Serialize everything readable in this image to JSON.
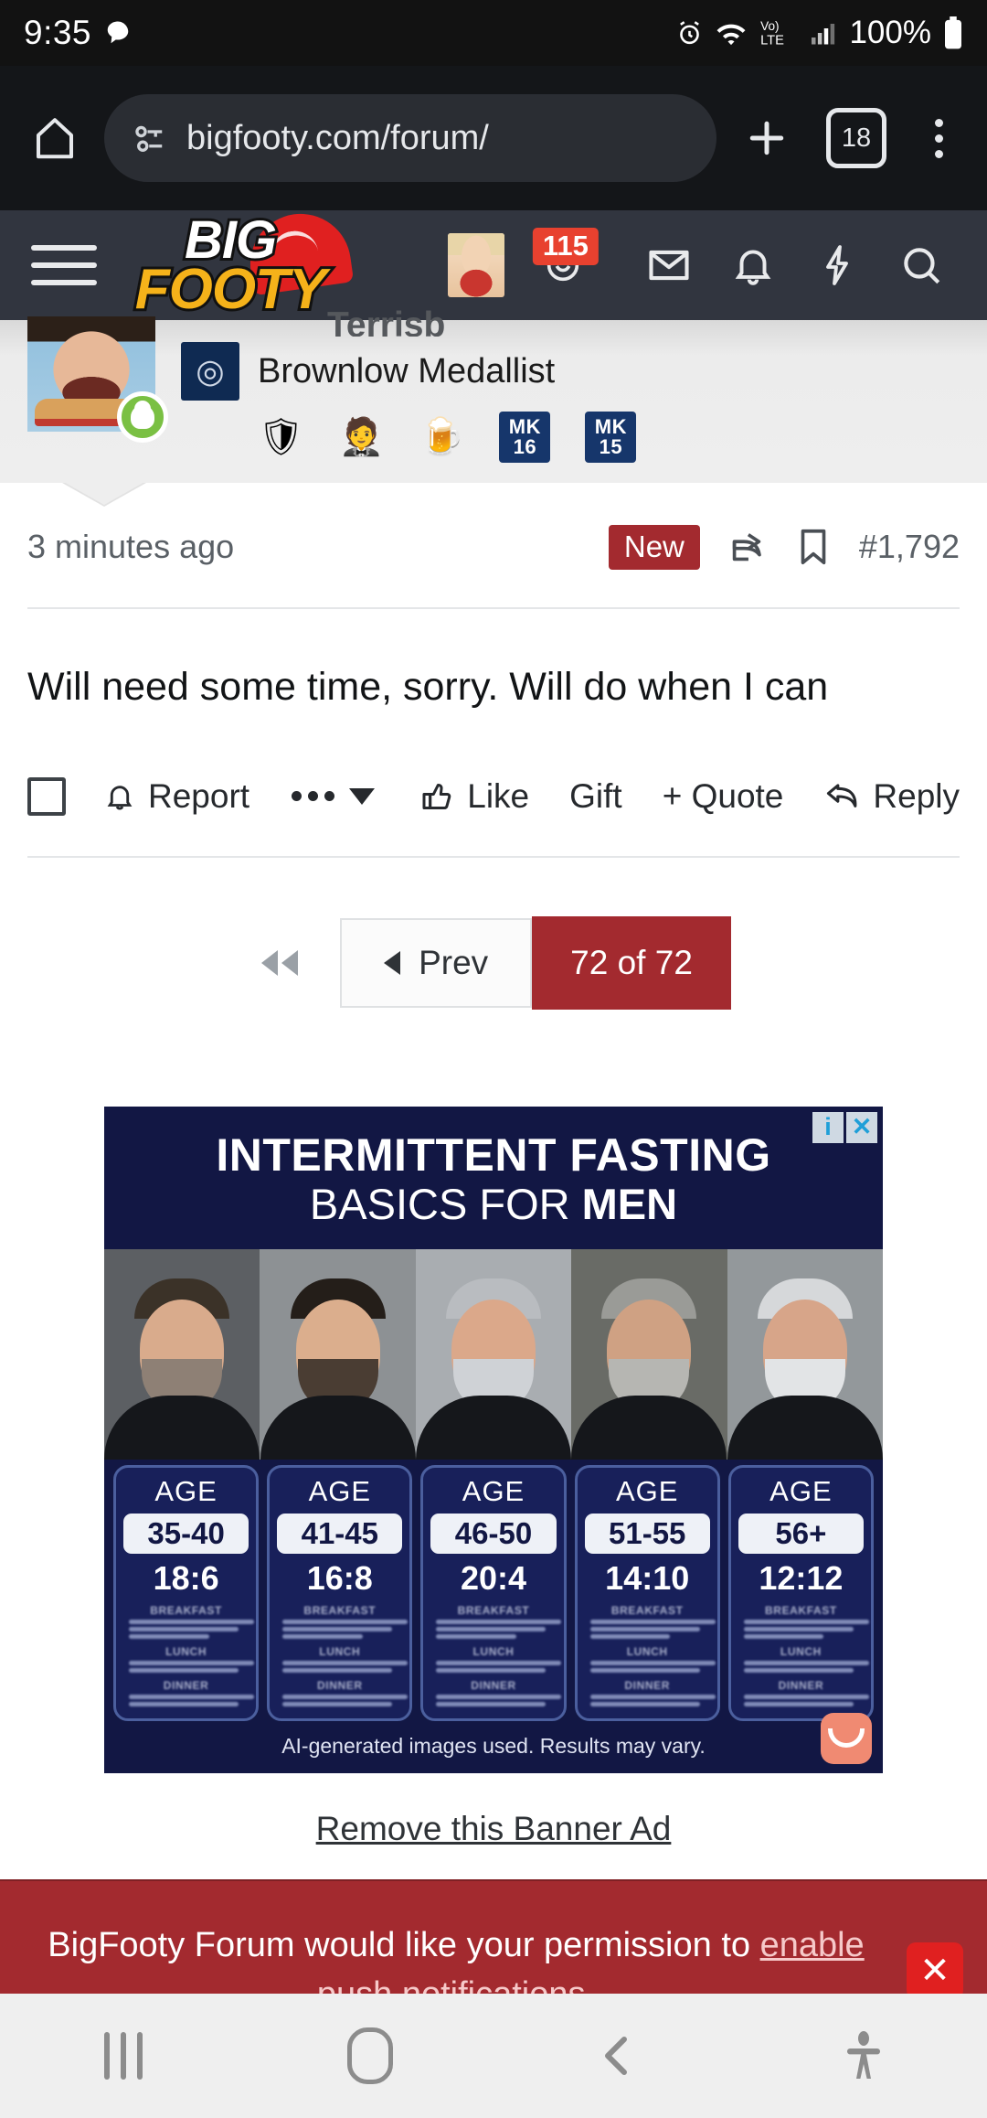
{
  "status_bar": {
    "time": "9:35",
    "battery_percent": "100%",
    "network_label": "LTE",
    "volte_label": "VoLTE",
    "icons": [
      "chat-bubble-icon",
      "alarm-icon",
      "wifi-icon",
      "volte-icon",
      "signal-bars-icon",
      "battery-icon"
    ]
  },
  "browser": {
    "url": "bigfooty.com/forum/",
    "tab_count": "18",
    "icons": [
      "home-icon",
      "site-settings-icon",
      "new-tab-icon",
      "tab-switcher-icon",
      "overflow-menu-icon"
    ]
  },
  "site_nav": {
    "logo_line1": "BIG",
    "logo_line2": "FOOTY",
    "alert_count": "115",
    "icons": [
      "hamburger-menu-icon",
      "user-avatar",
      "alerts-icon",
      "inbox-icon",
      "bell-icon",
      "whats-new-icon",
      "search-icon"
    ]
  },
  "post": {
    "username": "Terrisb",
    "user_title": "Brownlow Medallist",
    "badges": [
      "victory-shield-badge",
      "soldier-badge",
      "beer-mug-badge",
      "MK 16",
      "MK 15"
    ],
    "mk_badges": [
      {
        "top": "MK",
        "bottom": "16"
      },
      {
        "top": "MK",
        "bottom": "15"
      }
    ],
    "timestamp": "3 minutes ago",
    "new_label": "New",
    "post_number": "#1,792",
    "body": "Will need some time, sorry. Will do when I can",
    "actions": {
      "report": "Report",
      "like": "Like",
      "gift": "Gift",
      "quote": "+ Quote",
      "reply": "Reply"
    }
  },
  "pagination": {
    "first_label": "first-page",
    "prev_label": "Prev",
    "current_label": "72 of 72"
  },
  "ad": {
    "headline_line1": "INTERMITTENT FASTING",
    "headline_line2_pre": "BASICS FOR ",
    "headline_line2_bold": "MEN",
    "cards": [
      {
        "age_label": "AGE",
        "range": "35-40",
        "ratio": "18:6",
        "meals": [
          "BREAKFAST",
          "LUNCH",
          "DINNER"
        ],
        "face_skin": "#d9ab8c",
        "face_hair": "#3b3228",
        "face_beard": "#8e8075",
        "bg": "#5c5f63"
      },
      {
        "age_label": "AGE",
        "range": "41-45",
        "ratio": "16:8",
        "meals": [
          "BREAKFAST",
          "LUNCH",
          "DINNER"
        ],
        "face_skin": "#dbae8d",
        "face_hair": "#241e19",
        "face_beard": "#4a3d33",
        "bg": "#8d9194"
      },
      {
        "age_label": "AGE",
        "range": "46-50",
        "ratio": "20:4",
        "meals": [
          "BREAKFAST",
          "LUNCH",
          "DINNER"
        ],
        "face_skin": "#dba88a",
        "face_hair": "#b9bcc0",
        "face_beard": "#cfd2d6",
        "bg": "#a9adb1"
      },
      {
        "age_label": "AGE",
        "range": "51-55",
        "ratio": "14:10",
        "meals": [
          "BREAKFAST",
          "LUNCH",
          "DINNER"
        ],
        "face_skin": "#cfa183",
        "face_hair": "#9a9b97",
        "face_beard": "#b6b6b2",
        "bg": "#696b66"
      },
      {
        "age_label": "AGE",
        "range": "56+",
        "ratio": "12:12",
        "meals": [
          "BREAKFAST",
          "LUNCH",
          "DINNER"
        ],
        "face_skin": "#d7a589",
        "face_hair": "#d6d8da",
        "face_beard": "#e2e4e6",
        "bg": "#93989b"
      }
    ],
    "disclaimer": "AI-generated images used. Results may vary.",
    "info_icon": "i",
    "close_icon": "✕",
    "remove_link": "Remove this Banner Ad"
  },
  "push_bar": {
    "text_before": "BigFooty Forum would like your permission to ",
    "link_text": "enable push notifications",
    "text_after": ".",
    "close_label": "✕"
  },
  "nav_bar": {
    "icons": [
      "recents-icon",
      "home-icon",
      "back-icon",
      "accessibility-icon"
    ]
  },
  "colors": {
    "accent_red": "#a32a2f",
    "nav_dark": "#31353f",
    "browser_dark": "#141619",
    "ad_navy": "#121744"
  }
}
